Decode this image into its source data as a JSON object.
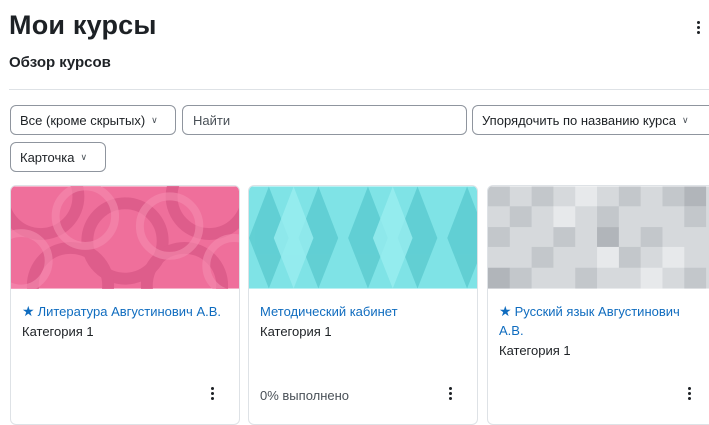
{
  "header": {
    "title": "Мои курсы",
    "menu_icon": "vertical-ellipsis-icon"
  },
  "overview": {
    "title": "Обзор курсов",
    "filter_label": "Все (кроме скрытых)",
    "search_placeholder": "Найти",
    "sort_label": "Упорядочить по названию курса",
    "view_label": "Карточка"
  },
  "colors": {
    "link": "#0f6cbf",
    "card1_bg": "#ef6f9b",
    "card2_bg": "#7fe3e6",
    "card3_bg": "#d6d9dc"
  },
  "courses": [
    {
      "name": "Литература Августинович А.В.",
      "category": "Категория 1",
      "starred": true,
      "progress": ""
    },
    {
      "name": "Методический кабинет",
      "category": "Категория 1",
      "starred": false,
      "progress": "0% выполнено"
    },
    {
      "name": "Русский язык Августинович А.В.",
      "category": "Категория 1",
      "starred": true,
      "progress": ""
    }
  ]
}
